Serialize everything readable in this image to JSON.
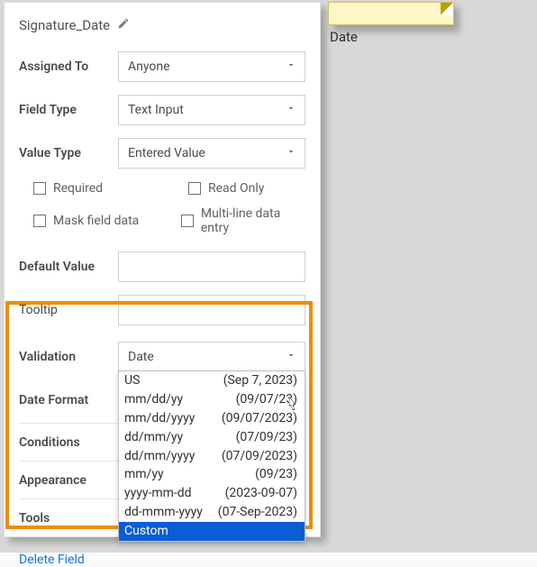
{
  "field_name": "Signature_Date",
  "assigned_to": {
    "label": "Assigned To",
    "value": "Anyone"
  },
  "field_type": {
    "label": "Field Type",
    "value": "Text Input"
  },
  "value_type": {
    "label": "Value Type",
    "value": "Entered Value"
  },
  "checkboxes": {
    "required": "Required",
    "read_only": "Read Only",
    "mask": "Mask field data",
    "multiline": "Multi-line data entry"
  },
  "default_value": {
    "label": "Default Value",
    "value": ""
  },
  "tooltip": {
    "label": "Tooltip",
    "value": ""
  },
  "validation": {
    "label": "Validation",
    "value": "Date"
  },
  "date_format": {
    "label": "Date Format",
    "selected_format": "US",
    "selected_sample": "(Sep 7, 2023)",
    "options": [
      {
        "format": "US",
        "sample": "(Sep 7, 2023)"
      },
      {
        "format": "mm/dd/yy",
        "sample": "(09/07/23)"
      },
      {
        "format": "mm/dd/yyyy",
        "sample": "(09/07/2023)"
      },
      {
        "format": "dd/mm/yy",
        "sample": "(07/09/23)"
      },
      {
        "format": "dd/mm/yyyy",
        "sample": "(07/09/2023)"
      },
      {
        "format": "mm/yy",
        "sample": "(09/23)"
      },
      {
        "format": "yyyy-mm-dd",
        "sample": "(2023-09-07)"
      },
      {
        "format": "dd-mmm-yyyy",
        "sample": "(07-Sep-2023)"
      },
      {
        "format": "Custom",
        "sample": ""
      }
    ]
  },
  "sections": {
    "conditions": "Conditions",
    "appearance": "Appearance",
    "tools": "Tools"
  },
  "delete_label": "Delete Field",
  "preview_label": "Date"
}
